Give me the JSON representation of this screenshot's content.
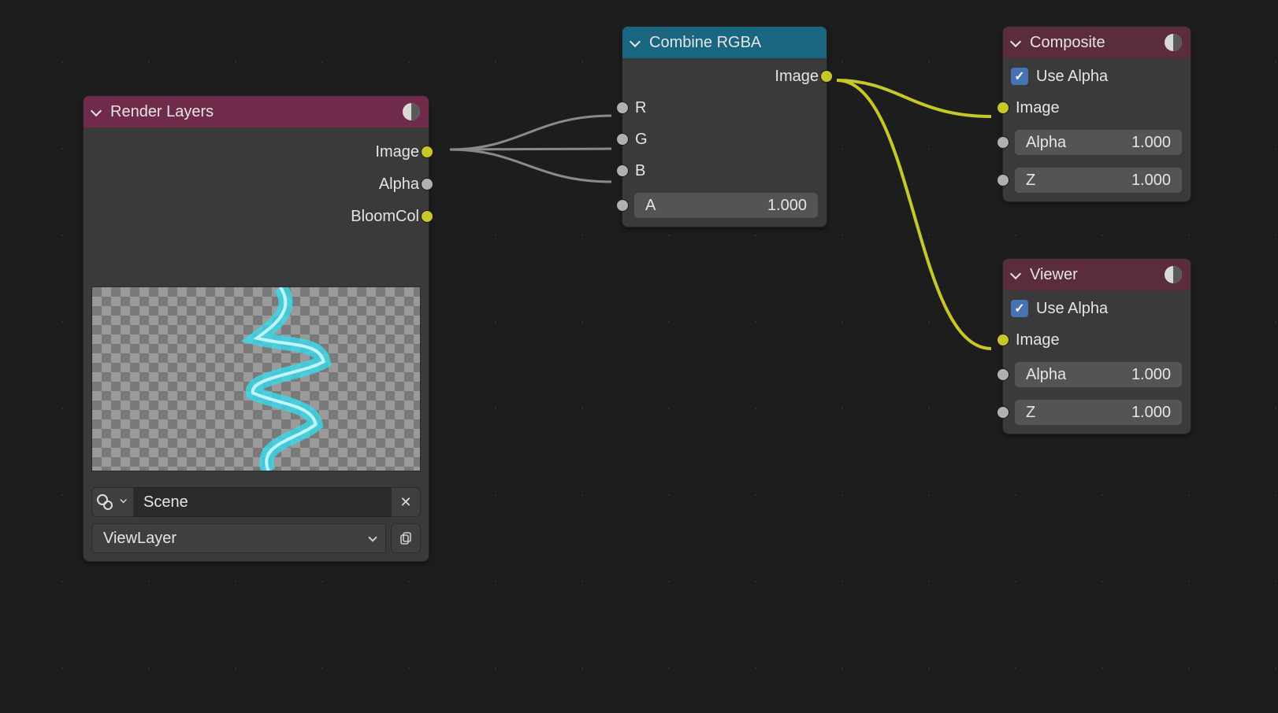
{
  "render_layers": {
    "title": "Render Layers",
    "outputs": [
      "Image",
      "Alpha",
      "BloomCol"
    ],
    "scene_field": "Scene",
    "viewlayer_field": "ViewLayer"
  },
  "combine_rgba": {
    "title": "Combine RGBA",
    "output": "Image",
    "inputs": {
      "r": "R",
      "g": "G",
      "b": "B",
      "a_label": "A",
      "a_value": "1.000"
    }
  },
  "composite": {
    "title": "Composite",
    "use_alpha": "Use Alpha",
    "image": "Image",
    "alpha": {
      "label": "Alpha",
      "value": "1.000"
    },
    "z": {
      "label": "Z",
      "value": "1.000"
    }
  },
  "viewer": {
    "title": "Viewer",
    "use_alpha": "Use Alpha",
    "image": "Image",
    "alpha": {
      "label": "Alpha",
      "value": "1.000"
    },
    "z": {
      "label": "Z",
      "value": "1.000"
    }
  }
}
